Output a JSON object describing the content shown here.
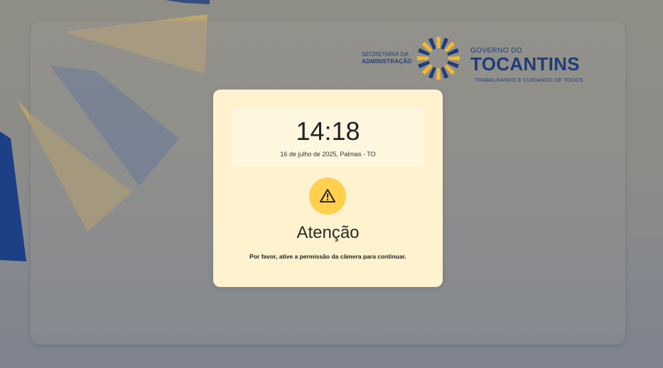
{
  "header_logo": {
    "secretaria_line1": "SECRETARIA DA",
    "secretaria_line2": "ADMINISTRAÇÃO",
    "governo_label": "GOVERNO DO",
    "state_name": "TOCANTINS",
    "tagline": "TRABALHANDO E CUIDANDO DE TODOS"
  },
  "modal": {
    "clock": {
      "time": "14:18",
      "date_location": "16 de julho de 2025, Palmas - TO"
    },
    "icon": "warning-icon",
    "title": "Atenção",
    "message": "Por favor, ative a permissão da câmera para continuar."
  },
  "colors": {
    "brand_blue": "#1e3d7b",
    "brand_yellow": "#f5b82e",
    "modal_background": "#fff2cf",
    "warning_circle": "#ffd04d"
  }
}
